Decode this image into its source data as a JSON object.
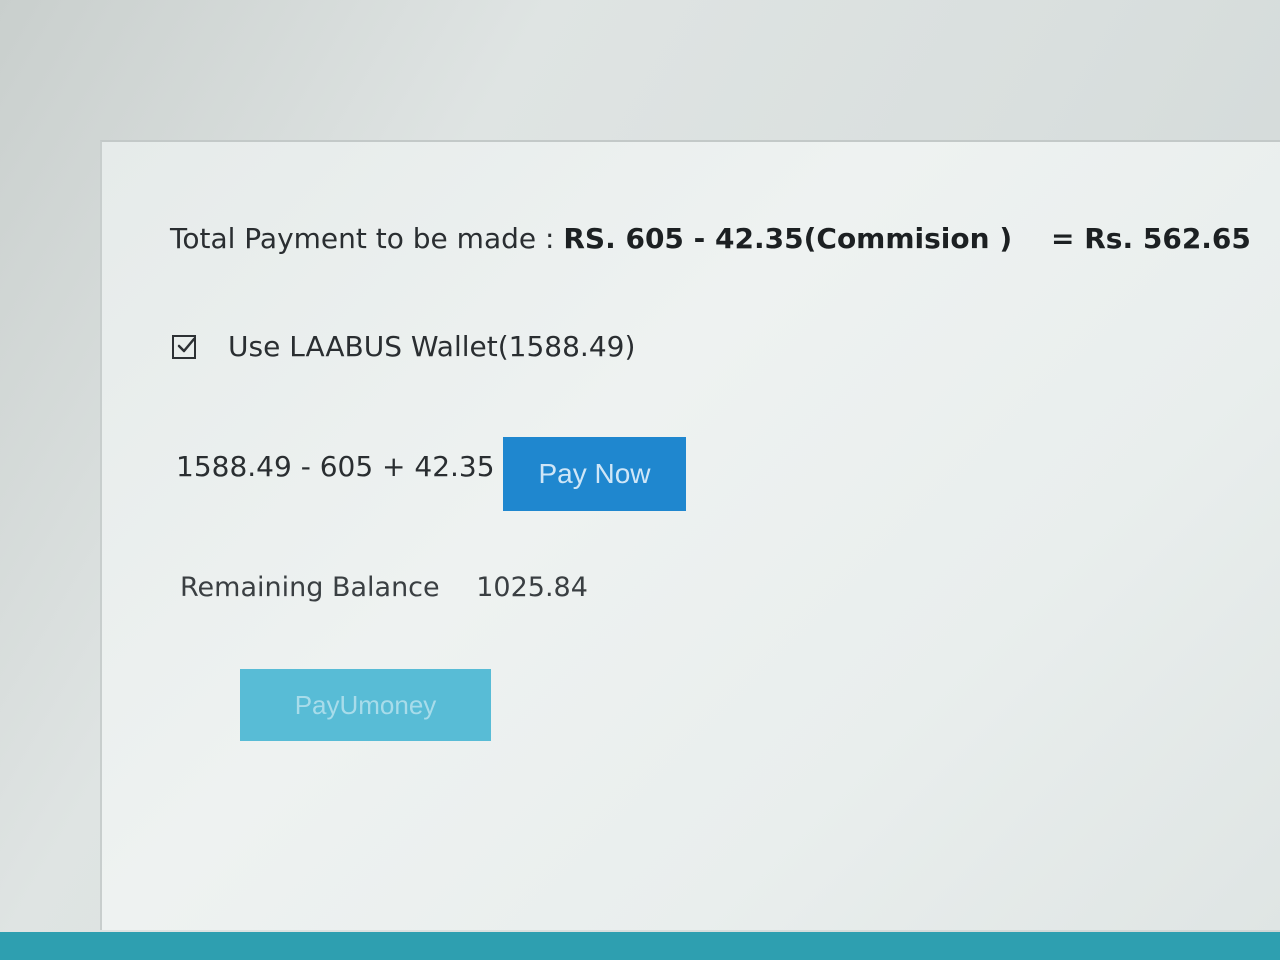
{
  "payment": {
    "total_label": "Total Payment to be made :",
    "total_expression": "RS. 605 - 42.35(Commision )",
    "total_result": "= Rs. 562.65"
  },
  "wallet": {
    "checked": true,
    "label": "Use LAABUS Wallet(1588.49)"
  },
  "calculation": {
    "expression": "1588.49 - 605 + 42.35",
    "pay_now_label": "Pay Now"
  },
  "balance": {
    "label": "Remaining Balance",
    "value": "1025.84"
  },
  "payumoney": {
    "label": "PayUmoney"
  },
  "colors": {
    "pay_now_bg": "#1f87cf",
    "payumoney_bg": "#58bcd6",
    "bottom_bar": "#2e9fb0"
  }
}
